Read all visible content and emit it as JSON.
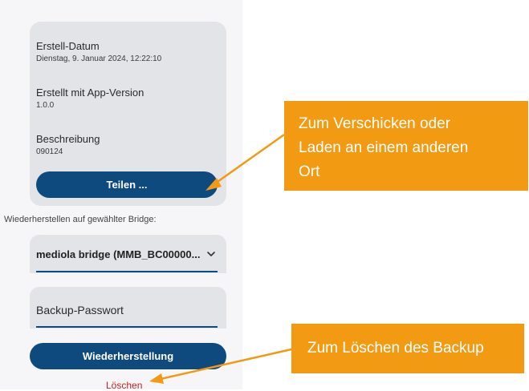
{
  "backup_details": {
    "created_date_label": "Erstell-Datum",
    "created_date_value": "Dienstag, 9. Januar 2024, 12:22:10",
    "app_version_label": "Erstellt mit App-Version",
    "app_version_value": "1.0.0",
    "description_label": "Beschreibung",
    "description_value": "090124",
    "share_button_label": "Teilen ..."
  },
  "restore": {
    "section_label": "Wiederherstellen auf gewählter Bridge:",
    "selected_bridge": "mediola bridge (MMB_BC00000...",
    "password_placeholder": "Backup-Passwort",
    "restore_button_label": "Wiederherstellung",
    "delete_label": "Löschen"
  },
  "annotations": {
    "share_callout_line1": "Zum Verschicken oder",
    "share_callout_line2": "Laden an einem anderen",
    "share_callout_line3": "Ort",
    "delete_callout": "Zum Löschen des Backup"
  },
  "colors": {
    "primary": "#0e4a7d",
    "callout": "#f29a11",
    "danger": "#c52121"
  }
}
